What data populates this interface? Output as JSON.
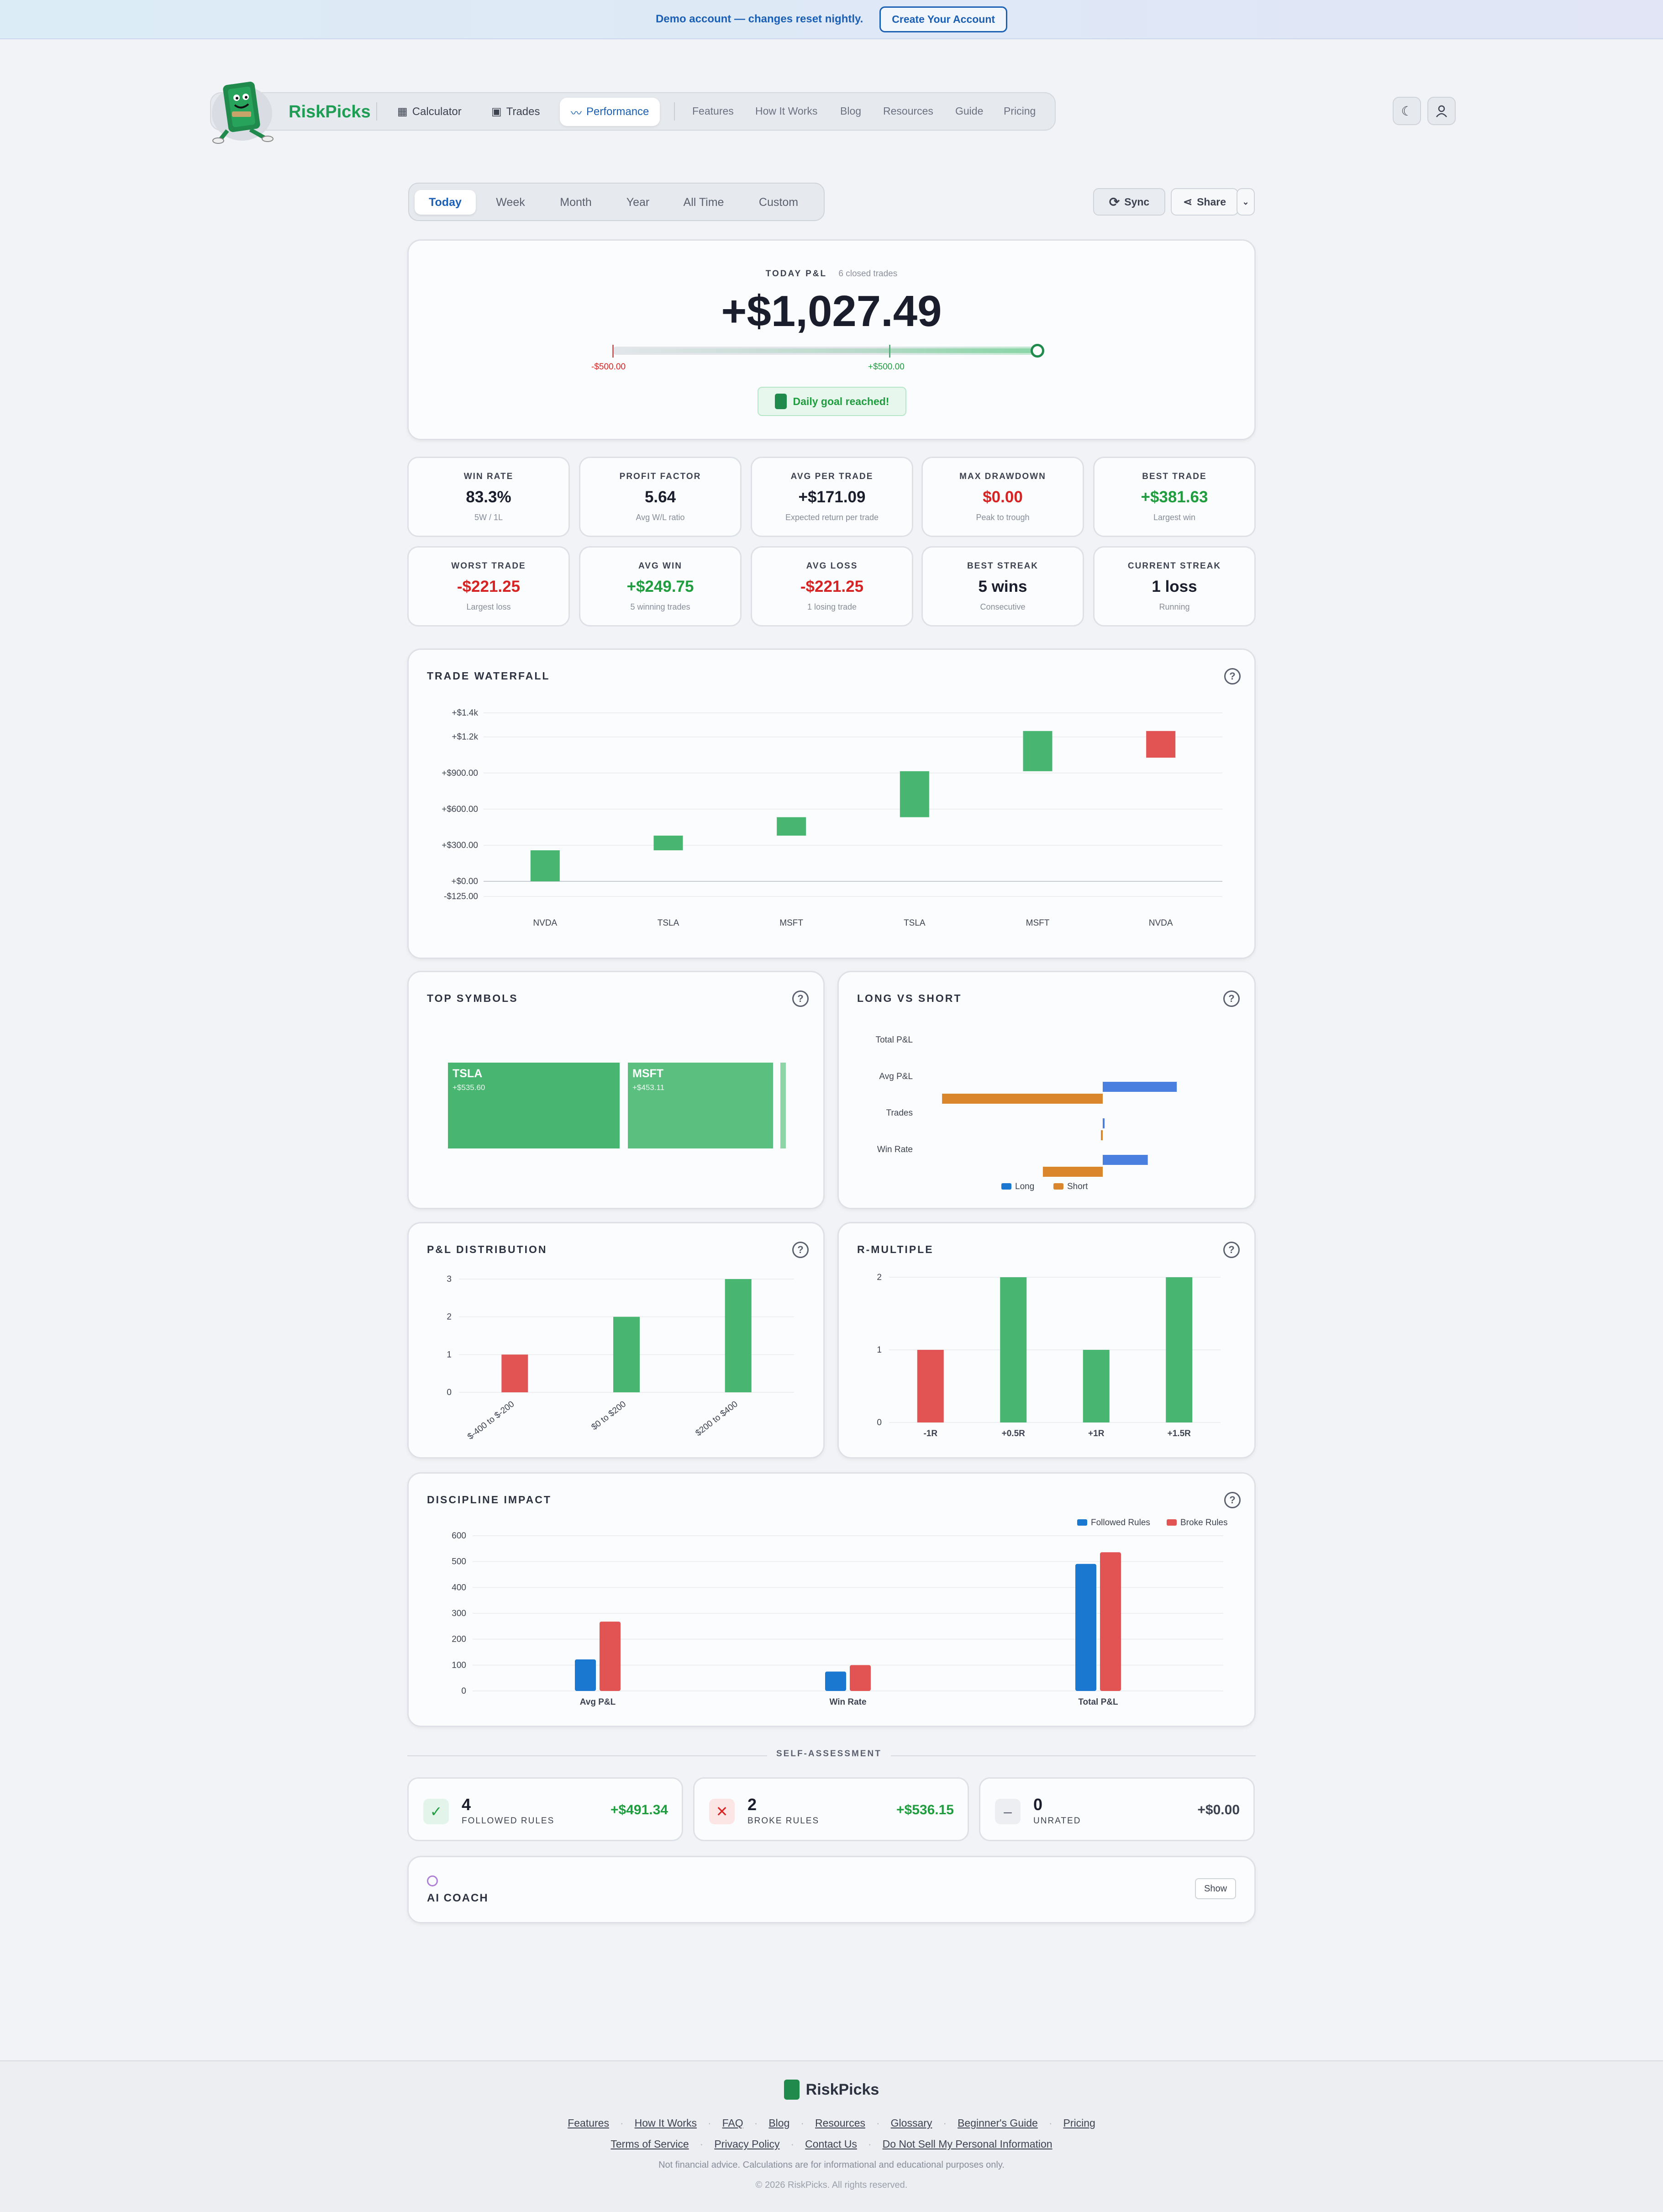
{
  "banner": {
    "text": "Demo account — changes reset nightly.",
    "cta": "Create Your Account"
  },
  "nav": {
    "brand": "RiskPicks",
    "tabs": [
      "Calculator",
      "Trades",
      "Performance"
    ],
    "links": [
      "Features",
      "How It Works",
      "Blog",
      "Resources",
      "Guide",
      "Pricing"
    ]
  },
  "periods": {
    "tabs": [
      "Today",
      "Week",
      "Month",
      "Year",
      "All Time",
      "Custom"
    ],
    "active": "Today"
  },
  "actions": {
    "sync": "Sync",
    "share": "Share"
  },
  "pnl": {
    "label": "TODAY P&L",
    "sub": "6 closed trades",
    "value": "+$1,027.49",
    "min_label": "-$500.00",
    "goal_label": "+$500.00",
    "goal_badge": "Daily goal reached!"
  },
  "stats": [
    {
      "label": "WIN RATE",
      "value": "83.3%",
      "sub": "5W / 1L",
      "tone": ""
    },
    {
      "label": "PROFIT FACTOR",
      "value": "5.64",
      "sub": "Avg W/L ratio",
      "tone": ""
    },
    {
      "label": "AVG PER TRADE",
      "value": "+$171.09",
      "sub": "Expected return per trade",
      "tone": ""
    },
    {
      "label": "MAX DRAWDOWN",
      "value": "$0.00",
      "sub": "Peak to trough",
      "tone": "neg"
    },
    {
      "label": "BEST TRADE",
      "value": "+$381.63",
      "sub": "Largest win",
      "tone": "pos"
    },
    {
      "label": "WORST TRADE",
      "value": "-$221.25",
      "sub": "Largest loss",
      "tone": "neg"
    },
    {
      "label": "AVG WIN",
      "value": "+$249.75",
      "sub": "5 winning trades",
      "tone": "pos"
    },
    {
      "label": "AVG LOSS",
      "value": "-$221.25",
      "sub": "1 losing trade",
      "tone": "neg"
    },
    {
      "label": "BEST STREAK",
      "value": "5 wins",
      "sub": "Consecutive",
      "tone": ""
    },
    {
      "label": "CURRENT STREAK",
      "value": "1 loss",
      "sub": "Running",
      "tone": ""
    }
  ],
  "cards": {
    "waterfall": "TRADE WATERFALL",
    "symbols": "TOP SYMBOLS",
    "long_short": "LONG VS SHORT",
    "distribution": "P&L DISTRIBUTION",
    "r_multiple": "R-MULTIPLE",
    "discipline": "DISCIPLINE IMPACT"
  },
  "symbols": [
    {
      "name": "TSLA",
      "value": "+$535.60"
    },
    {
      "name": "MSFT",
      "value": "+$453.11"
    }
  ],
  "colors": {
    "green": "#48b571",
    "red": "#e25353",
    "blue": "#1a78d0",
    "orange": "#d9862d",
    "long_blue": "#4a7fe0"
  },
  "chart_data": [
    {
      "type": "bar",
      "title": "TRADE WATERFALL",
      "categories": [
        "NVDA",
        "TSLA",
        "MSFT",
        "TSLA",
        "MSFT",
        "NVDA"
      ],
      "steps": [
        {
          "start": 0,
          "end": 258
        },
        {
          "start": 258,
          "end": 380
        },
        {
          "start": 380,
          "end": 533
        },
        {
          "start": 533,
          "end": 915
        },
        {
          "start": 915,
          "end": 1249
        },
        {
          "start": 1249,
          "end": 1027.49
        }
      ],
      "yticks": [
        "+$1.4k",
        "+$1.2k",
        "+$900.00",
        "+$600.00",
        "+$300.00",
        "+$0.00",
        "-$125.00"
      ],
      "ylim": [
        -125,
        1400
      ]
    },
    {
      "type": "bar",
      "title": "LONG VS SHORT",
      "categories": [
        "Total P&L",
        "Avg P&L",
        "Trades",
        "Win Rate"
      ],
      "series": [
        {
          "name": "Long",
          "values": [
            0,
            235,
            5,
            143
          ]
        },
        {
          "name": "Short",
          "values": [
            0,
            -510,
            -1,
            -190
          ]
        }
      ]
    },
    {
      "type": "bar",
      "title": "P&L DISTRIBUTION",
      "categories": [
        "$-400 to $-200",
        "$0 to $200",
        "$200 to $400"
      ],
      "values": [
        1,
        2,
        3
      ],
      "yticks": [
        "0",
        "1",
        "2",
        "3"
      ],
      "ylim": [
        0,
        3
      ]
    },
    {
      "type": "bar",
      "title": "R-MULTIPLE",
      "categories": [
        "-1R",
        "+0.5R",
        "+1R",
        "+1.5R"
      ],
      "values": [
        1,
        2,
        1,
        2
      ],
      "yticks": [
        "0",
        "1",
        "2"
      ],
      "ylim": [
        0,
        2
      ]
    },
    {
      "type": "bar",
      "title": "DISCIPLINE IMPACT",
      "categories": [
        "Avg P&L",
        "Win Rate",
        "Total P&L"
      ],
      "series": [
        {
          "name": "Followed Rules",
          "values": [
            122,
            75,
            491
          ]
        },
        {
          "name": "Broke Rules",
          "values": [
            268,
            100,
            536
          ]
        }
      ],
      "yticks": [
        "0",
        "100",
        "200",
        "300",
        "400",
        "500",
        "600"
      ],
      "ylim": [
        0,
        600
      ]
    }
  ],
  "self_assessment": {
    "title": "SELF-ASSESSMENT",
    "items": [
      {
        "count": "4",
        "label": "FOLLOWED RULES",
        "amount": "+$491.34"
      },
      {
        "count": "2",
        "label": "BROKE RULES",
        "amount": "+$536.15"
      },
      {
        "count": "0",
        "label": "UNRATED",
        "amount": "+$0.00"
      }
    ]
  },
  "ai_coach": {
    "title": "AI COACH",
    "button": "Show"
  },
  "footer": {
    "brand": "RiskPicks",
    "links1": [
      "Features",
      "How It Works",
      "FAQ",
      "Blog",
      "Resources",
      "Glossary",
      "Beginner's Guide",
      "Pricing"
    ],
    "links2": [
      "Terms of Service",
      "Privacy Policy",
      "Contact Us",
      "Do Not Sell My Personal Information"
    ],
    "disclaimer": "Not financial advice. Calculations are for informational and educational purposes only.",
    "copyright": "© 2026 RiskPicks. All rights reserved."
  }
}
